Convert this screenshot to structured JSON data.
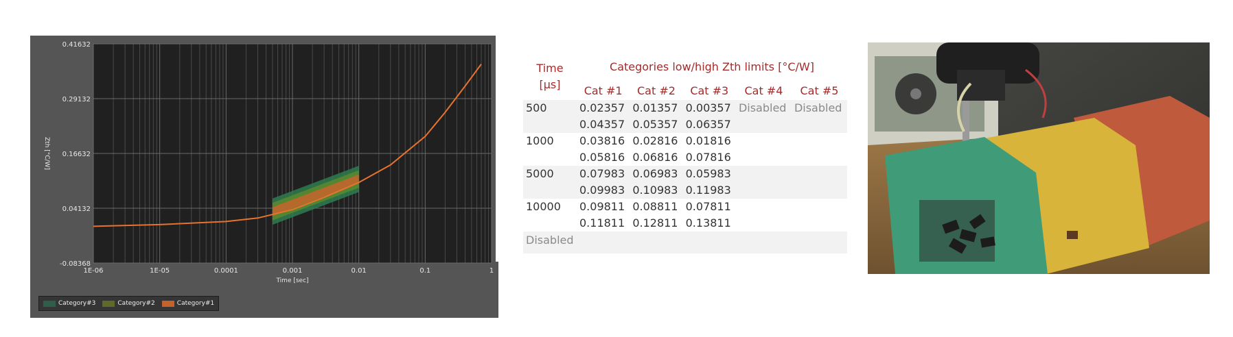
{
  "chart": {
    "legend": [
      {
        "label": "Category#3",
        "color": "#2f5e4d"
      },
      {
        "label": "Category#2",
        "color": "#5d6a2a"
      },
      {
        "label": "Category#1",
        "color": "#c4622c"
      }
    ]
  },
  "chart_data": {
    "type": "line",
    "title": "",
    "xlabel": "Time [sec]",
    "ylabel": "Zth [°C/W]",
    "xscale": "log",
    "xlim": [
      1e-06,
      1
    ],
    "ylim": [
      -0.08368,
      0.41632
    ],
    "x_tick_labels": [
      "1E-06",
      "1E-05",
      "0.0001",
      "0.001",
      "0.01",
      "0.1",
      "1"
    ],
    "y_tick_labels": [
      "0.41632",
      "0.29132",
      "0.16632",
      "0.04132",
      "-0.08368"
    ],
    "y_ticks": [
      0.41632,
      0.29132,
      0.16632,
      0.04132,
      -0.08368
    ],
    "grid": true,
    "legend_position": "bottom-left",
    "series": [
      {
        "name": "",
        "color": "#e8732f",
        "x": [
          1e-06,
          1e-05,
          0.0001,
          0.0003,
          0.001,
          0.003,
          0.01,
          0.03,
          0.1,
          0.2,
          0.4,
          0.7
        ],
        "y": [
          0.0,
          0.004,
          0.011,
          0.019,
          0.038,
          0.066,
          0.1,
          0.14,
          0.205,
          0.26,
          0.32,
          0.37
        ]
      }
    ],
    "bands": [
      {
        "name": "Category#3",
        "color": "#2e7d4f",
        "x": [
          0.0005,
          0.01
        ],
        "low": [
          0.00357,
          0.07811
        ],
        "high": [
          0.06357,
          0.13811
        ]
      },
      {
        "name": "Category#2",
        "color": "#5c8a2e",
        "x": [
          0.0005,
          0.01
        ],
        "low": [
          0.01357,
          0.08811
        ],
        "high": [
          0.05357,
          0.12811
        ]
      },
      {
        "name": "Category#1",
        "color": "#c8642c",
        "x": [
          0.0005,
          0.01
        ],
        "low": [
          0.02357,
          0.09811
        ],
        "high": [
          0.04357,
          0.11811
        ]
      }
    ]
  },
  "table": {
    "time_header": [
      "Time",
      "[µs]"
    ],
    "title": "Categories low/high Zth limits [°C/W]",
    "columns": [
      "Cat #1",
      "Cat #2",
      "Cat #3",
      "Cat #4",
      "Cat #5"
    ],
    "rows": [
      {
        "time": "500",
        "low": [
          "0.02357",
          "0.01357",
          "0.00357",
          "Disabled",
          "Disabled"
        ],
        "high": [
          "0.04357",
          "0.05357",
          "0.06357",
          "",
          ""
        ]
      },
      {
        "time": "1000",
        "low": [
          "0.03816",
          "0.02816",
          "0.01816",
          "",
          ""
        ],
        "high": [
          "0.05816",
          "0.06816",
          "0.07816",
          "",
          ""
        ]
      },
      {
        "time": "5000",
        "low": [
          "0.07983",
          "0.06983",
          "0.05983",
          "",
          ""
        ],
        "high": [
          "0.09983",
          "0.10983",
          "0.11983",
          "",
          ""
        ]
      },
      {
        "time": "10000",
        "low": [
          "0.09811",
          "0.08811",
          "0.07811",
          "",
          ""
        ],
        "high": [
          "0.11811",
          "0.12811",
          "0.13811",
          "",
          ""
        ]
      }
    ],
    "footer_row": "Disabled"
  },
  "photo": {
    "colors": {
      "green_bin": "#3f9b78",
      "yellow_bin": "#d9b43a",
      "red_bin": "#c05a3c"
    }
  }
}
